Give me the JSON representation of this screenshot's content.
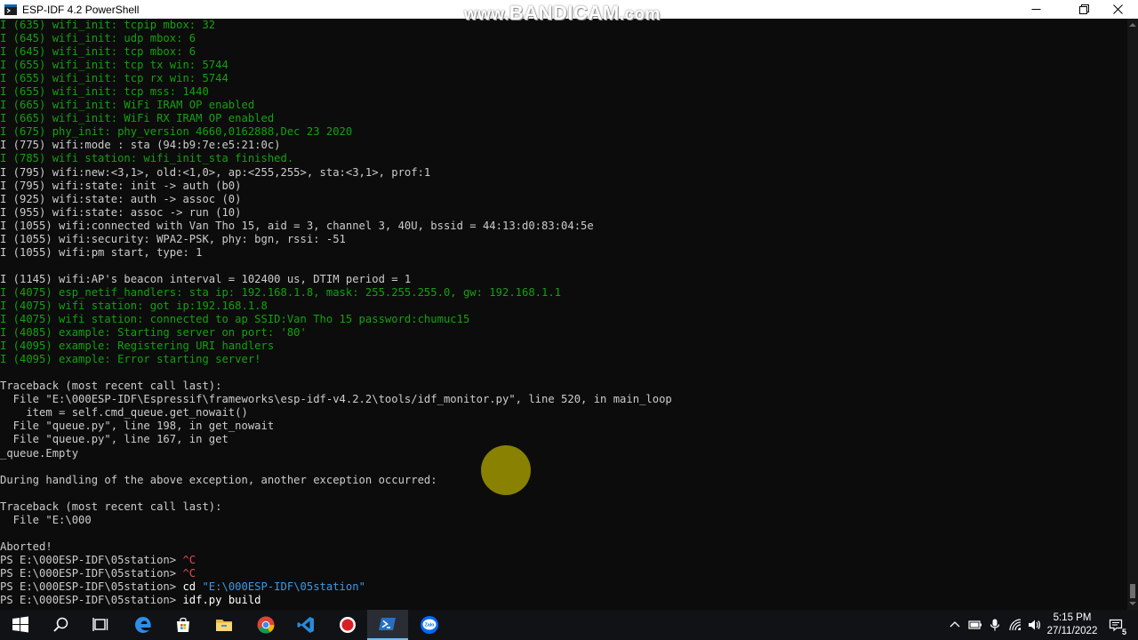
{
  "window": {
    "title": "ESP-IDF 4.2 PowerShell",
    "watermark_prefix": "www.",
    "watermark_brand": "BANDICAM",
    "watermark_suffix": ".com"
  },
  "console_lines": [
    {
      "text": "I (635) wifi_init: tcpip mbox: 32",
      "style": "green"
    },
    {
      "text": "I (645) wifi_init: udp mbox: 6",
      "style": "green"
    },
    {
      "text": "I (645) wifi_init: tcp mbox: 6",
      "style": "green"
    },
    {
      "text": "I (655) wifi_init: tcp tx win: 5744",
      "style": "green"
    },
    {
      "text": "I (655) wifi_init: tcp rx win: 5744",
      "style": "green"
    },
    {
      "text": "I (655) wifi_init: tcp mss: 1440",
      "style": "green"
    },
    {
      "text": "I (665) wifi_init: WiFi IRAM OP enabled",
      "style": "green"
    },
    {
      "text": "I (665) wifi_init: WiFi RX IRAM OP enabled",
      "style": "green"
    },
    {
      "text": "I (675) phy_init: phy_version 4660,0162888,Dec 23 2020",
      "style": "green"
    },
    {
      "text": "I (775) wifi:mode : sta (94:b9:7e:e5:21:0c)",
      "style": "plain"
    },
    {
      "text": "I (785) wifi station: wifi_init_sta finished.",
      "style": "green"
    },
    {
      "text": "I (795) wifi:new:<3,1>, old:<1,0>, ap:<255,255>, sta:<3,1>, prof:1",
      "style": "plain"
    },
    {
      "text": "I (795) wifi:state: init -> auth (b0)",
      "style": "plain"
    },
    {
      "text": "I (925) wifi:state: auth -> assoc (0)",
      "style": "plain"
    },
    {
      "text": "I (955) wifi:state: assoc -> run (10)",
      "style": "plain"
    },
    {
      "text": "I (1055) wifi:connected with Van Tho 15, aid = 3, channel 3, 40U, bssid = 44:13:d0:83:04:5e",
      "style": "plain"
    },
    {
      "text": "I (1055) wifi:security: WPA2-PSK, phy: bgn, rssi: -51",
      "style": "plain"
    },
    {
      "text": "I (1055) wifi:pm start, type: 1",
      "style": "plain"
    },
    {
      "text": "",
      "style": "plain"
    },
    {
      "text": "I (1145) wifi:AP's beacon interval = 102400 us, DTIM period = 1",
      "style": "plain"
    },
    {
      "text": "I (4075) esp_netif_handlers: sta ip: 192.168.1.8, mask: 255.255.255.0, gw: 192.168.1.1",
      "style": "green"
    },
    {
      "text": "I (4075) wifi station: got ip:192.168.1.8",
      "style": "green"
    },
    {
      "text": "I (4075) wifi station: connected to ap SSID:Van Tho 15 password:chumuc15",
      "style": "green"
    },
    {
      "text": "I (4085) example: Starting server on port: '80'",
      "style": "green"
    },
    {
      "text": "I (4095) example: Registering URI handlers",
      "style": "green"
    },
    {
      "text": "I (4095) example: Error starting server!",
      "style": "green"
    },
    {
      "text": "",
      "style": "plain"
    },
    {
      "text": "Traceback (most recent call last):",
      "style": "plain"
    },
    {
      "text": "  File \"E:\\000ESP-IDF\\Espressif\\frameworks\\esp-idf-v4.2.2\\tools/idf_monitor.py\", line 520, in main_loop",
      "style": "plain"
    },
    {
      "text": "    item = self.cmd_queue.get_nowait()",
      "style": "plain"
    },
    {
      "text": "  File \"queue.py\", line 198, in get_nowait",
      "style": "plain"
    },
    {
      "text": "  File \"queue.py\", line 167, in get",
      "style": "plain"
    },
    {
      "text": "_queue.Empty",
      "style": "plain"
    },
    {
      "text": "",
      "style": "plain"
    },
    {
      "text": "During handling of the above exception, another exception occurred:",
      "style": "plain"
    },
    {
      "text": "",
      "style": "plain"
    },
    {
      "text": "Traceback (most recent call last):",
      "style": "plain"
    },
    {
      "text": "  File \"E:\\000",
      "style": "plain"
    },
    {
      "text": "",
      "style": "plain"
    },
    {
      "text": "Aborted!",
      "style": "plain"
    }
  ],
  "prompt_lines": [
    {
      "prompt": "PS E:\\000ESP-IDF\\05station> ",
      "cmd": "^C",
      "cmd_style": "ctrlc",
      "arg": "",
      "arg_style": ""
    },
    {
      "prompt": "PS E:\\000ESP-IDF\\05station> ",
      "cmd": "^C",
      "cmd_style": "ctrlc",
      "arg": "",
      "arg_style": ""
    },
    {
      "prompt": "PS E:\\000ESP-IDF\\05station> ",
      "cmd": "cd ",
      "cmd_style": "cmd-yellow",
      "arg": "\"E:\\000ESP-IDF\\05station\"",
      "arg_style": "str"
    },
    {
      "prompt": "PS E:\\000ESP-IDF\\05station> ",
      "cmd": "idf.py build",
      "cmd_style": "cmd-yellow",
      "arg": "",
      "arg_style": ""
    }
  ],
  "taskbar": {
    "apps": [
      "windows-start-icon",
      "search-icon",
      "task-view-icon",
      "edge-icon",
      "file-explorer-icon",
      "chrome-icon",
      "vscode-icon",
      "record-icon",
      "powershell-icon",
      "zalo-icon"
    ],
    "zalo_label": "Zalo",
    "clock_time": "5:15 PM",
    "clock_date": "27/11/2022",
    "notification_count": "5"
  }
}
